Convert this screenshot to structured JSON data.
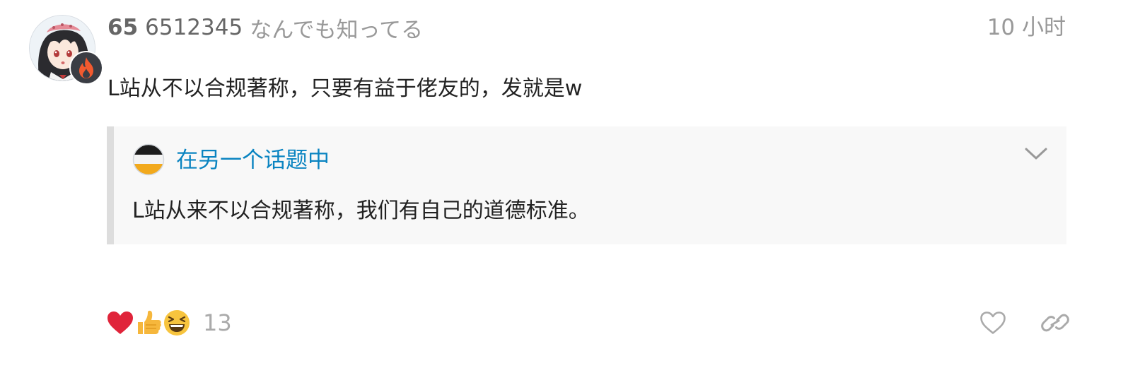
{
  "post": {
    "author": {
      "username": "65",
      "full_name": "6512345",
      "user_title": "なんでも知ってる",
      "avatar_icon": "anime-girl-avatar",
      "flair_icon": "fire-icon"
    },
    "date": "10 小时",
    "body": "L站从不以合规著称，只要有益于佬友的，发就是w",
    "quote": {
      "avatar_icon": "topic-avatar",
      "title": "在另一个话题中",
      "text": "L站从来不以合规著称，我们有自己的道德标准。",
      "toggle_icon": "chevron-down-icon"
    },
    "reactions": {
      "items": [
        "heart",
        "thumbsup",
        "laughing"
      ],
      "count": "13"
    },
    "actions": [
      "like-button",
      "copy-link-button"
    ]
  },
  "colors": {
    "link_blue": "#0a84c1",
    "heart_red": "#e0243a",
    "muted_text": "#999999",
    "quote_bg": "#f8f8f8",
    "quote_border": "#dddddd"
  }
}
